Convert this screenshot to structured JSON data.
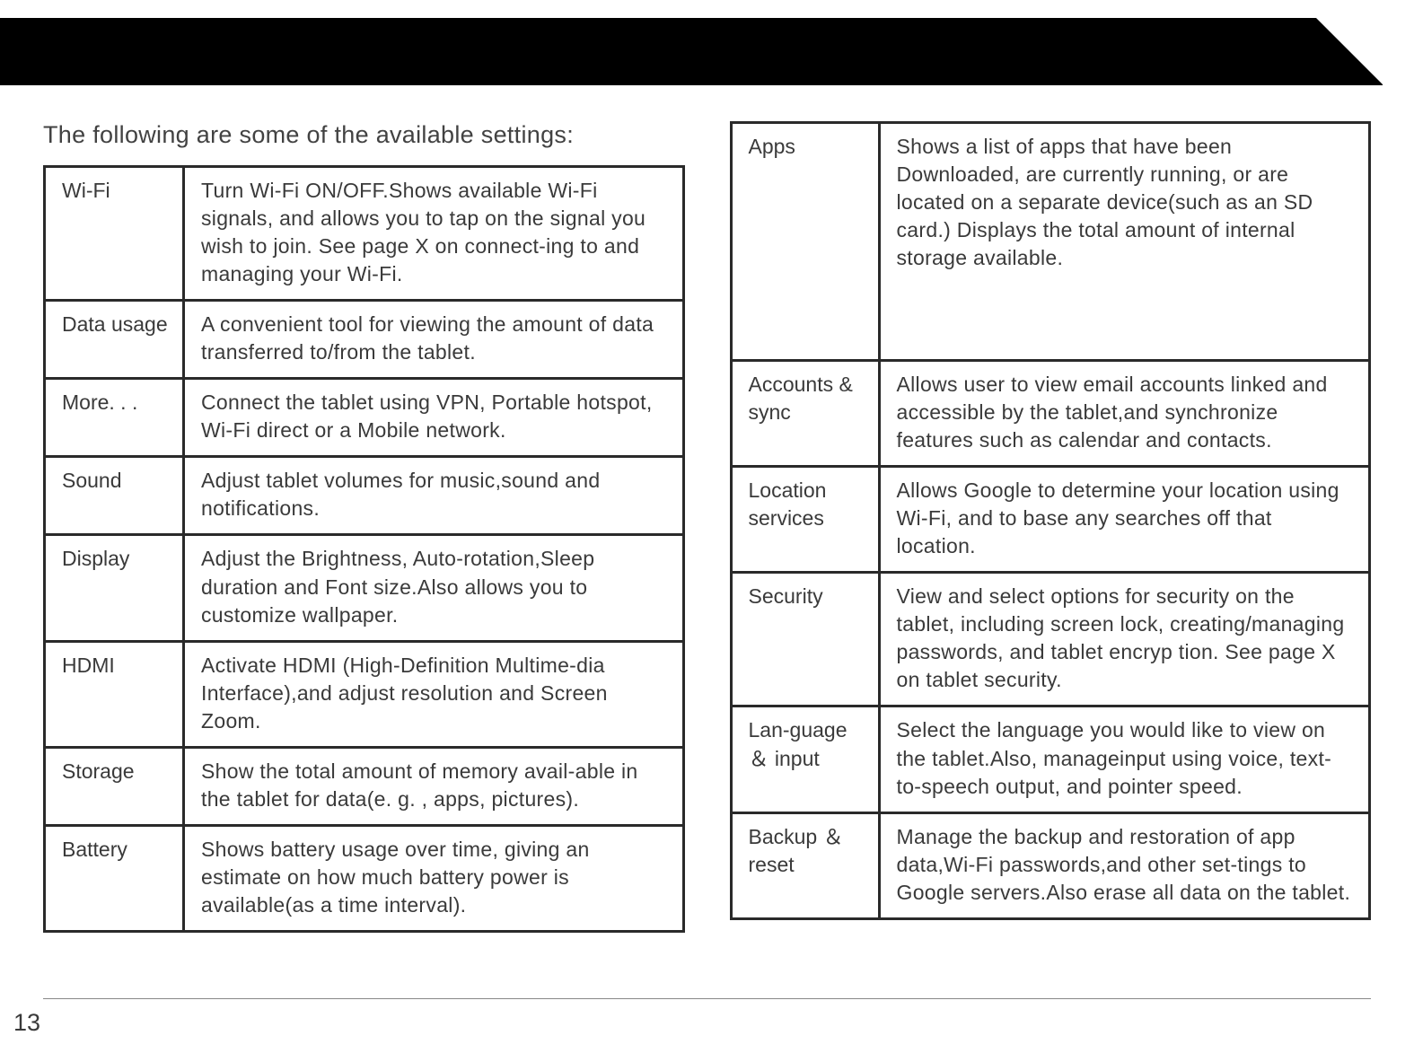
{
  "intro": "The following are some of the available settings:",
  "page_number": "13",
  "left_table": [
    {
      "label": "Wi-Fi",
      "desc": "Turn Wi-Fi ON/OFF.Shows available Wi-Fi signals, and allows you to tap on the signal you wish to join. See page X on connect-ing to and managing your Wi-Fi."
    },
    {
      "label": "Data usage",
      "desc": "A  convenient tool  for  viewing  the  amount of  data transferred  to/from  the  tablet."
    },
    {
      "label": "More. . .",
      "desc": "Connect  the  tablet  using  VPN,   Portable hotspot,   Wi-Fi  direct  or  a  Mobile network."
    },
    {
      "label": "Sound",
      "desc": "Adjust  tablet  volumes  for  music,sound  and  notifications."
    },
    {
      "label": "Display",
      "desc": "Adjust  the  Brightness,   Auto-rotation,Sleep duration and Font size.Also allows you to customize wallpaper."
    },
    {
      "label": "HDMI",
      "desc": "Activate  HDMI (High-Definition Multime-dia Interface),and adjust resolution and Screen  Zoom."
    },
    {
      "label": "Storage",
      "desc": "Show  the  total  amount  of  memory avail-able  in  the  tablet  for  data(e. g. ,   apps, pictures)."
    },
    {
      "label": "Battery",
      "desc": "Shows  battery usage over time, giving an estimate on how much battery power is available(as a time interval)."
    }
  ],
  "right_table": [
    {
      "label": "Apps",
      "desc": "Shows a list of apps that have been Downloaded, are currently running, or are located on a separate device(such as an SD card.) Displays the total amount of internal storage available.",
      "tall": true
    },
    {
      "label": "Accounts & sync",
      "desc": "Allows  user  to  view  email  accounts linked and accessible by the tablet,and synchronize  features  such  as  calendar and contacts."
    },
    {
      "label": "Location services",
      "desc": "Allows  Google to  determine  your  location using  Wi-Fi,   and  to  base  any  searches  off that  location."
    },
    {
      "label": "Security",
      "desc": "View  and  select  options  for  security  on  the  tablet,   including screen  lock,   creating/managing   passwords, and  tablet  encryp tion. See  page X  on  tablet  security."
    },
    {
      "label": "Lan-guage ＆ input",
      "desc": "Select  the  language  you would like to view  on  the  tablet.Also,   manageinput  using voice,   text-to-speech output,   and  pointer speed."
    },
    {
      "label": "Backup  ＆ reset",
      "desc": "Manage the backup and restoration of app data,Wi-Fi passwords,and other set-tings  to  Google servers.Also erase all data on the tablet."
    }
  ]
}
